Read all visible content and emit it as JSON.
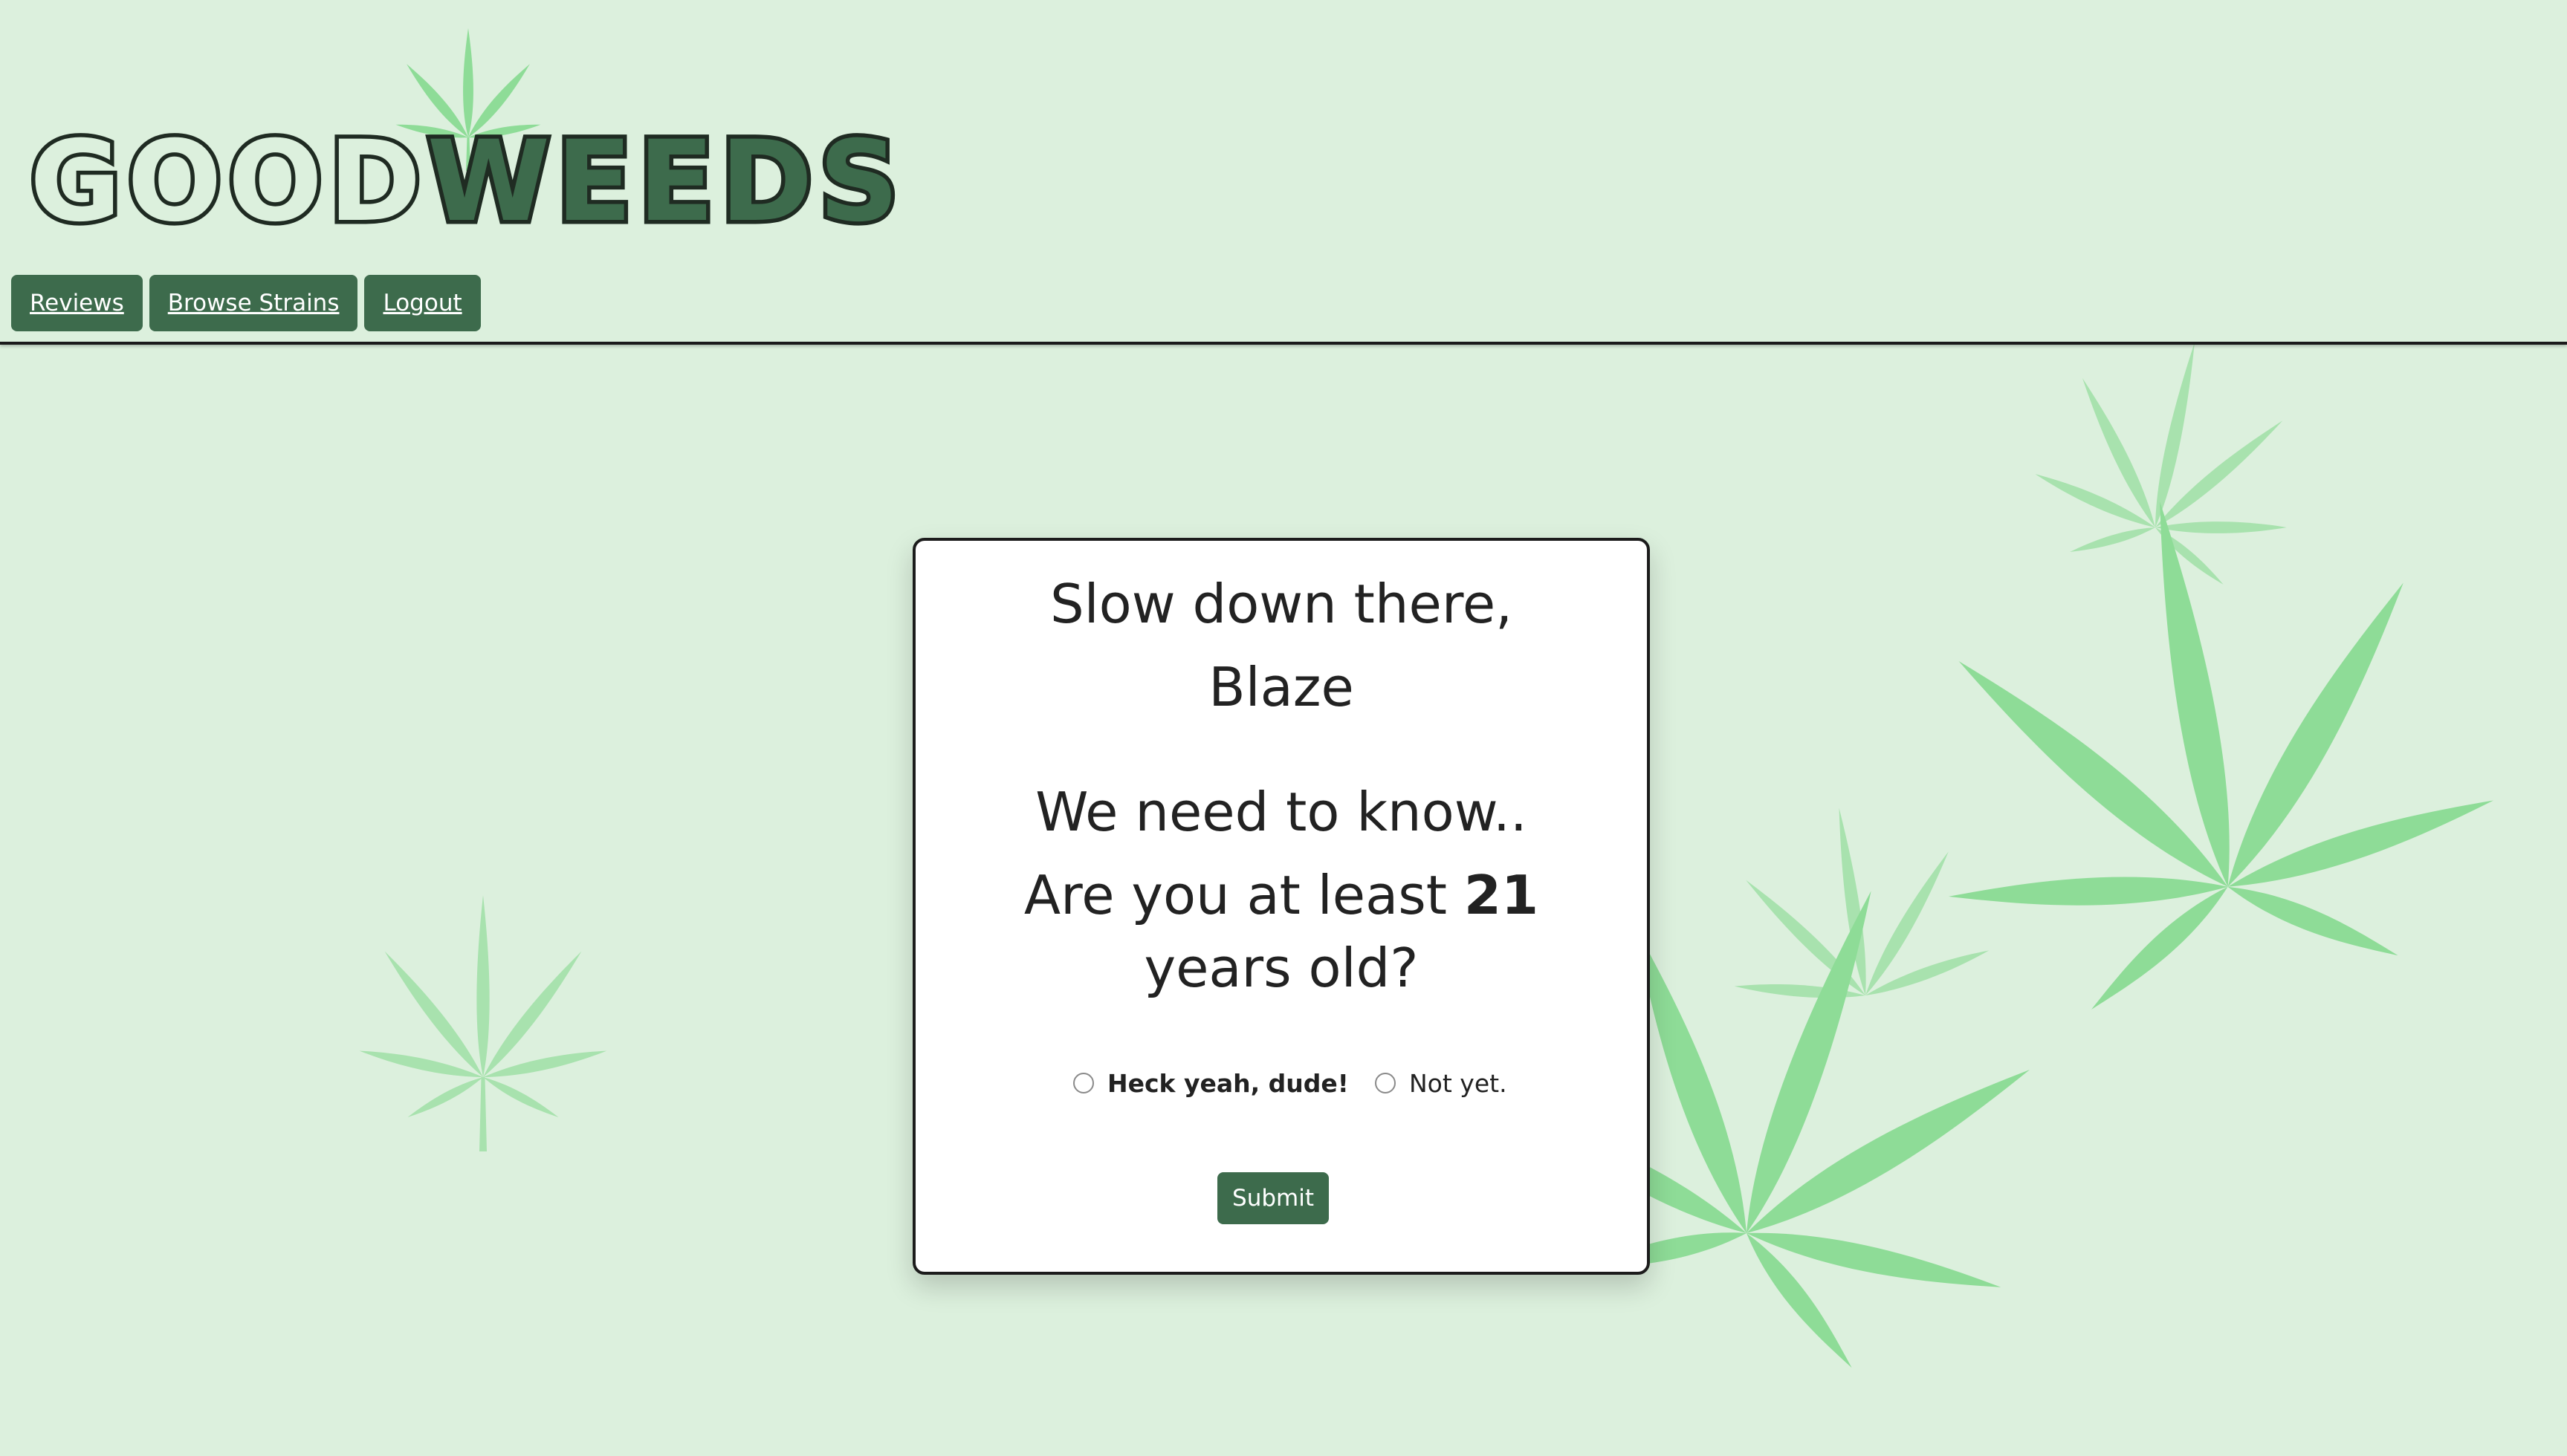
{
  "app": {
    "logo_text_a": "GOOD",
    "logo_text_b": "WEEDS",
    "accent_color": "#3d6b4c",
    "background_color": "#dcf0dd",
    "leaf_color": "#8edc97"
  },
  "nav": {
    "items": [
      {
        "label": "Reviews"
      },
      {
        "label": "Browse Strains"
      },
      {
        "label": "Logout"
      }
    ]
  },
  "card": {
    "greeting_line1": "Slow down there,",
    "greeting_line2": "Blaze",
    "question_line1": "We need to know..",
    "question_line2_prefix": "Are you at least ",
    "question_age": "21",
    "question_line3": "years old?",
    "options": [
      {
        "label": "Heck yeah, dude!",
        "selected": false
      },
      {
        "label": "Not yet.",
        "selected": false
      }
    ],
    "submit_label": "Submit"
  }
}
